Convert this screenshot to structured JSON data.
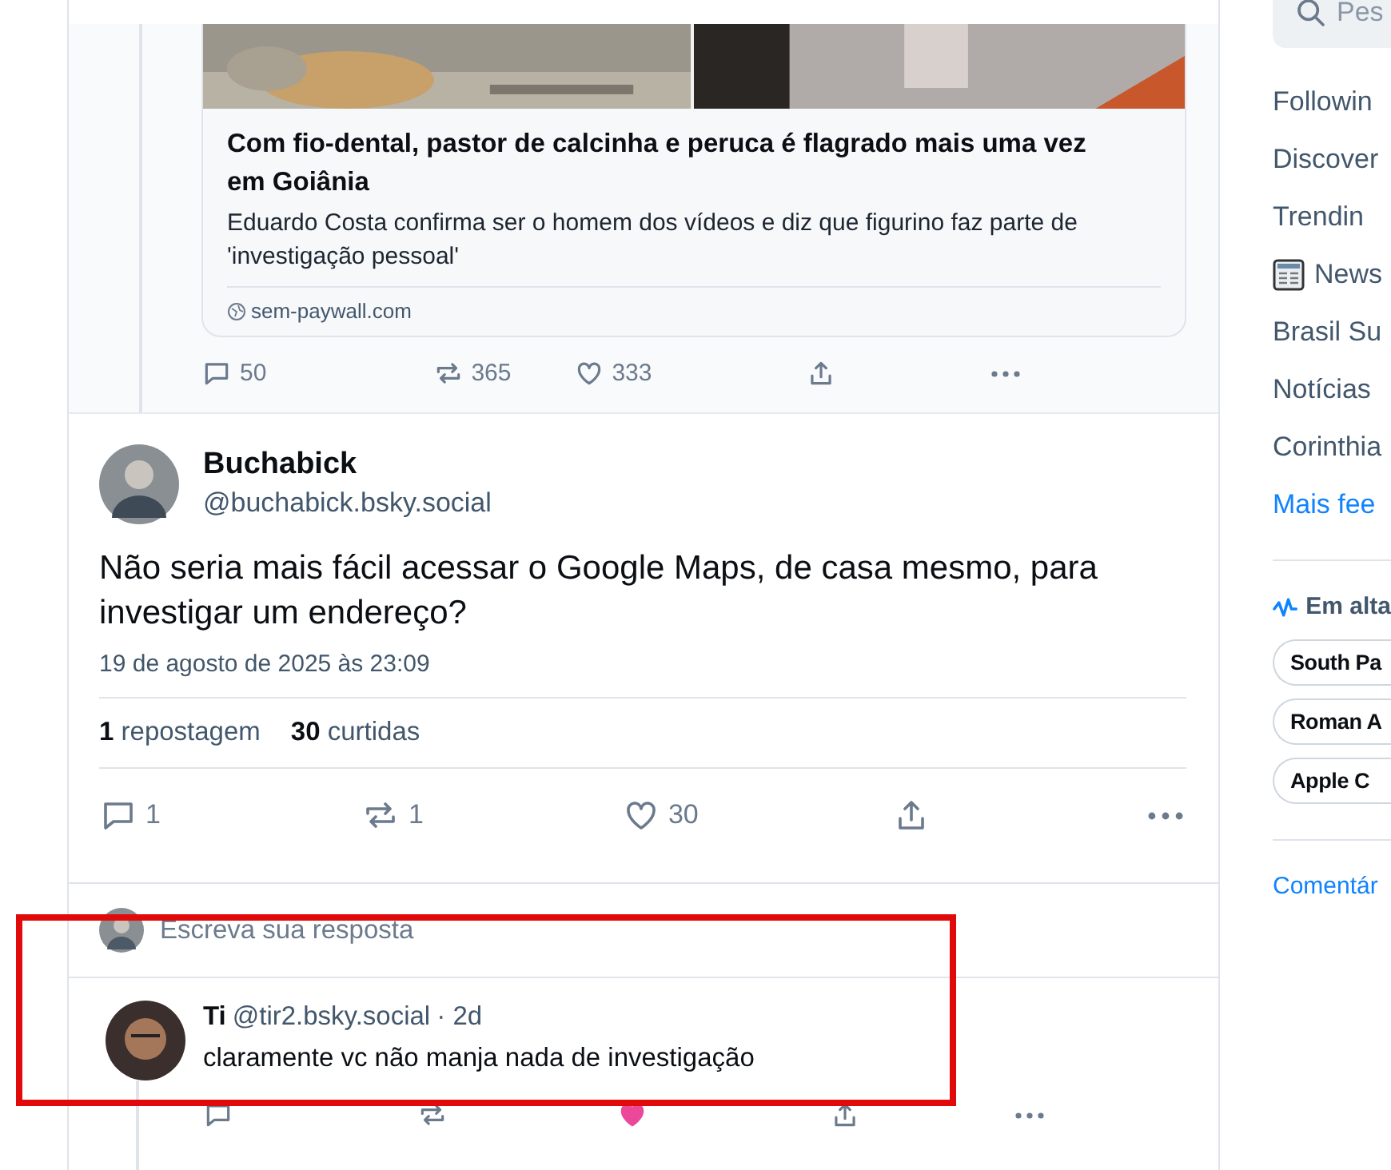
{
  "parent_post": {
    "link_card": {
      "title": "Com fio-dental, pastor de calcinha e peruca é flagrado mais uma vez em Goiânia",
      "description": "Eduardo Costa confirma ser o homem dos vídeos e diz que figurino faz parte de 'investigação pessoal'",
      "domain": "sem-paywall.com"
    },
    "actions": {
      "replies": "50",
      "reposts": "365",
      "likes": "333",
      "liked": false
    }
  },
  "post": {
    "author": "Buchabick",
    "handle": "@buchabick.bsky.social",
    "text": "Não seria mais fácil acessar o Google Maps, de casa mesmo, para investigar um endereço?",
    "date": "19 de agosto de 2025 às 23:09",
    "stats": [
      {
        "count": "1",
        "label": "repostagem"
      },
      {
        "count": "30",
        "label": "curtidas"
      }
    ],
    "actions": {
      "replies": "1",
      "reposts": "1",
      "likes": "30",
      "liked": false
    }
  },
  "composer": {
    "placeholder": "Escreva sua resposta"
  },
  "reply": {
    "author": "Ti",
    "handle": "@tir2.bsky.social",
    "time": "· 2d",
    "text": "claramente vc não manja nada de investigação",
    "actions": {
      "liked": true
    }
  },
  "sidebar": {
    "search": {
      "placeholder": "Pes"
    },
    "feeds": [
      {
        "label": "Followin",
        "kind": "plain"
      },
      {
        "label": "Discover",
        "kind": "plain"
      },
      {
        "label": "Trendin",
        "kind": "plain"
      },
      {
        "label": "News",
        "kind": "icon"
      },
      {
        "label": "Brasil Su",
        "kind": "plain"
      },
      {
        "label": "Notícias",
        "kind": "plain"
      },
      {
        "label": "Corinthia",
        "kind": "plain"
      },
      {
        "label": "Mais fee",
        "kind": "link"
      }
    ],
    "trending": {
      "title": "Em alta",
      "topics": [
        "South Pa",
        "Roman A",
        "Apple C"
      ]
    },
    "footer_link": "Comentár"
  }
}
